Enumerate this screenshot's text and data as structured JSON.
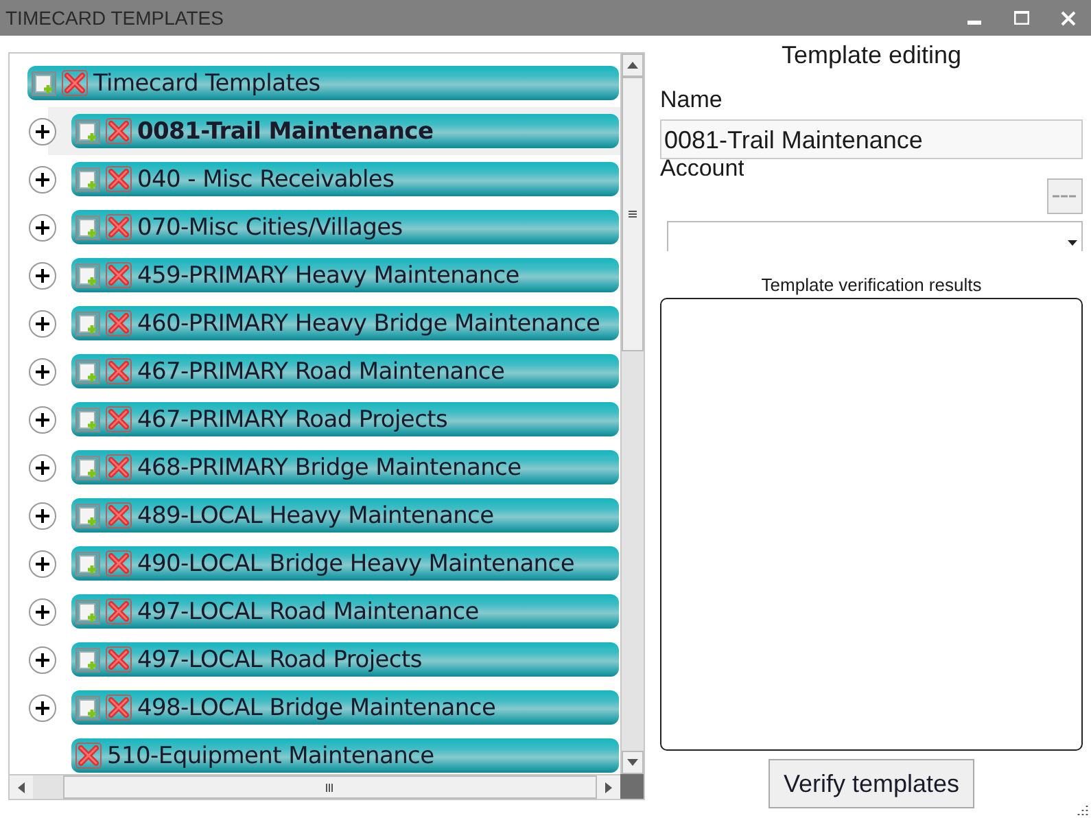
{
  "window": {
    "title": "TIMECARD TEMPLATES"
  },
  "tree": {
    "root": {
      "label": "Timecard Templates",
      "children": [
        {
          "label": "0081-Trail Maintenance",
          "kind": "folder",
          "selected": true
        },
        {
          "label": "040 - Misc Receivables",
          "kind": "folder",
          "selected": false
        },
        {
          "label": "070-Misc Cities/Villages",
          "kind": "folder",
          "selected": false
        },
        {
          "label": "459-PRIMARY Heavy Maintenance",
          "kind": "folder",
          "selected": false
        },
        {
          "label": "460-PRIMARY Heavy Bridge Maintenance",
          "kind": "folder",
          "selected": false
        },
        {
          "label": "467-PRIMARY Road Maintenance",
          "kind": "folder",
          "selected": false
        },
        {
          "label": "467-PRIMARY Road Projects",
          "kind": "folder",
          "selected": false
        },
        {
          "label": "468-PRIMARY Bridge Maintenance",
          "kind": "folder",
          "selected": false
        },
        {
          "label": "489-LOCAL Heavy Maintenance",
          "kind": "folder",
          "selected": false
        },
        {
          "label": "490-LOCAL Bridge Heavy Maintenance",
          "kind": "folder",
          "selected": false
        },
        {
          "label": "497-LOCAL Road Maintenance",
          "kind": "folder",
          "selected": false
        },
        {
          "label": "497-LOCAL Road Projects",
          "kind": "folder",
          "selected": false
        },
        {
          "label": "498-LOCAL Bridge Maintenance",
          "kind": "folder",
          "selected": false
        },
        {
          "label": "510-Equipment Maintenance",
          "kind": "item",
          "selected": false
        }
      ]
    }
  },
  "editor": {
    "title": "Template editing",
    "name_label": "Name",
    "name_value": "0081-Trail Maintenance",
    "account_label": "Account",
    "results_label": "Template verification results",
    "verify_button": "Verify templates"
  }
}
